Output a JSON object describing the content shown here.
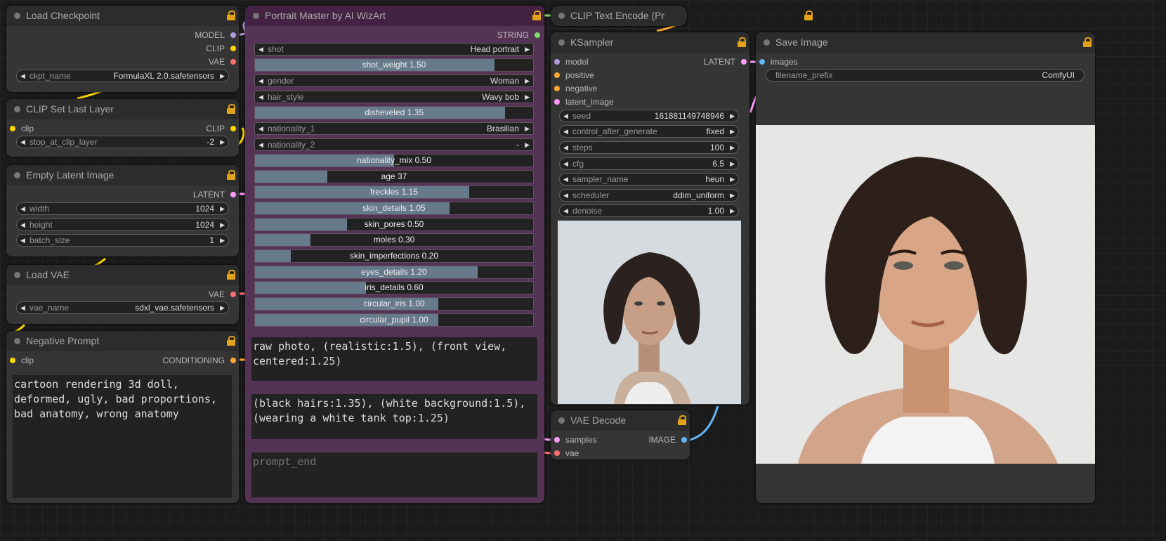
{
  "colors": {
    "model": "#b39ddb",
    "clip": "#ffd500",
    "vae": "#ff6e6e",
    "latent": "#ff9cf9",
    "conditioning": "#ffa931",
    "image": "#64b5f6",
    "string": "#7ddb6e",
    "lock": "#e3a218"
  },
  "load_checkpoint": {
    "title": "Load Checkpoint",
    "out_model": "MODEL",
    "out_clip": "CLIP",
    "out_vae": "VAE",
    "ckpt_key": "ckpt_name",
    "ckpt_val": "FormulaXL 2.0.safetensors"
  },
  "clip_set_last_layer": {
    "title": "CLIP Set Last Layer",
    "in_clip": "clip",
    "out_clip": "CLIP",
    "key": "stop_at_clip_layer",
    "val": "-2"
  },
  "empty_latent": {
    "title": "Empty Latent Image",
    "out_latent": "LATENT",
    "width_key": "width",
    "width_val": "1024",
    "height_key": "height",
    "height_val": "1024",
    "batch_key": "batch_size",
    "batch_val": "1"
  },
  "load_vae": {
    "title": "Load VAE",
    "out_vae": "VAE",
    "key": "vae_name",
    "val": "sdxl_vae.safetensors"
  },
  "negative_prompt": {
    "title": "Negative Prompt",
    "in_clip": "clip",
    "out_cond": "CONDITIONING",
    "text": "cartoon rendering 3d doll, deformed, ugly, bad proportions, bad anatomy, wrong anatomy"
  },
  "portrait_master": {
    "title": "Portrait Master by AI WizArt",
    "out_string": "STRING",
    "combos": {
      "shot": {
        "key": "shot",
        "val": "Head portrait"
      },
      "gender": {
        "key": "gender",
        "val": "Woman"
      },
      "hair_style": {
        "key": "hair_style",
        "val": "Wavy bob"
      },
      "nationality_1": {
        "key": "nationality_1",
        "val": "Brasilian"
      },
      "nationality_2": {
        "key": "nationality_2",
        "val": "-"
      }
    },
    "sliders": [
      {
        "label": "shot_weight  1.50",
        "fraction": 0.86
      },
      {
        "label": "disheveled  1.35",
        "fraction": 0.9
      },
      {
        "label": "nationality_mix  0.50",
        "fraction": 0.5
      },
      {
        "label": "age  37",
        "fraction": 0.26
      },
      {
        "label": "freckles  1.15",
        "fraction": 0.77
      },
      {
        "label": "skin_details  1.05",
        "fraction": 0.7
      },
      {
        "label": "skin_pores  0.50",
        "fraction": 0.33
      },
      {
        "label": "moles  0.30",
        "fraction": 0.2
      },
      {
        "label": "skin_imperfections  0.20",
        "fraction": 0.13
      },
      {
        "label": "eyes_details  1.20",
        "fraction": 0.8
      },
      {
        "label": "iris_details  0.60",
        "fraction": 0.4
      },
      {
        "label": "circular_iris  1.00",
        "fraction": 0.66
      },
      {
        "label": "circular_pupil  1.00",
        "fraction": 0.66
      }
    ],
    "prompt_start": "raw photo, (realistic:1.5), (front view, centered:1.25)",
    "prompt_additional": "(black hairs:1.35), (white background:1.5), (wearing a white tank top:1.25)",
    "prompt_end_placeholder": "prompt_end"
  },
  "clip_text_encode": {
    "title": "CLIP Text Encode (Pr"
  },
  "ksampler": {
    "title": "KSampler",
    "in_model": "model",
    "in_positive": "positive",
    "in_negative": "negative",
    "in_latent": "latent_image",
    "out_latent": "LATENT",
    "seed_key": "seed",
    "seed_val": "161881149748946",
    "cag_key": "control_after_generate",
    "cag_val": "fixed",
    "steps_key": "steps",
    "steps_val": "100",
    "cfg_key": "cfg",
    "cfg_val": "6.5",
    "sampler_key": "sampler_name",
    "sampler_val": "heun",
    "scheduler_key": "scheduler",
    "scheduler_val": "ddim_uniform",
    "denoise_key": "denoise",
    "denoise_val": "1.00"
  },
  "vae_decode": {
    "title": "VAE Decode",
    "in_samples": "samples",
    "in_vae": "vae",
    "out_image": "IMAGE"
  },
  "save_image": {
    "title": "Save Image",
    "in_images": "images",
    "prefix_key": "filename_prefix",
    "prefix_val": "ComfyUI"
  }
}
